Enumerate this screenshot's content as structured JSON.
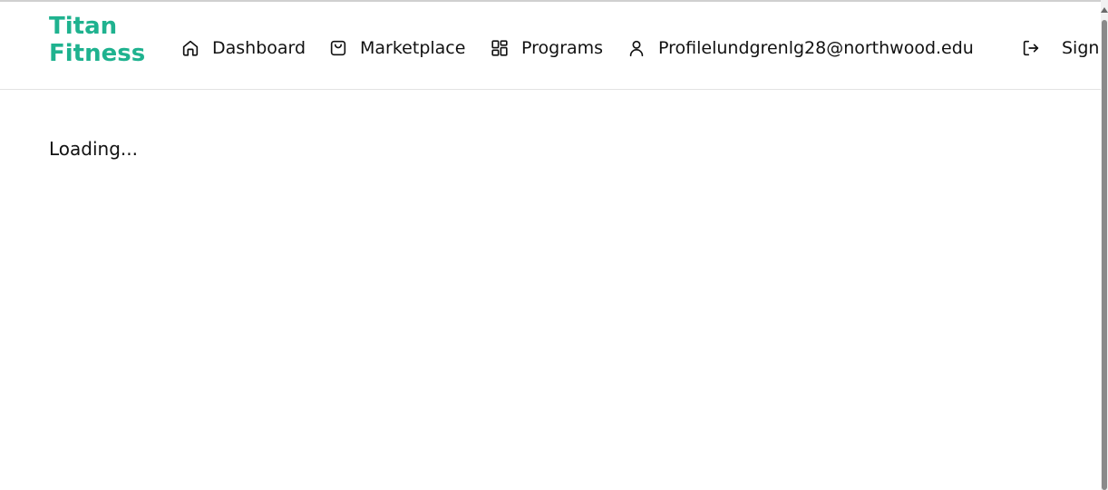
{
  "brand": {
    "name": "Titan Fitness",
    "color": "#1fb28f"
  },
  "nav": {
    "dashboard": {
      "label": "Dashboard",
      "icon": "home-icon"
    },
    "marketplace": {
      "label": "Marketplace",
      "icon": "shopping-bag-icon"
    },
    "programs": {
      "label": "Programs",
      "icon": "grid-icon"
    },
    "profile": {
      "label": "Profilelundgrenlg28@northwood.edu",
      "icon": "user-icon"
    },
    "signout": {
      "label": "Sign",
      "icon": "sign-out-icon"
    }
  },
  "main": {
    "status_text": "Loading..."
  }
}
